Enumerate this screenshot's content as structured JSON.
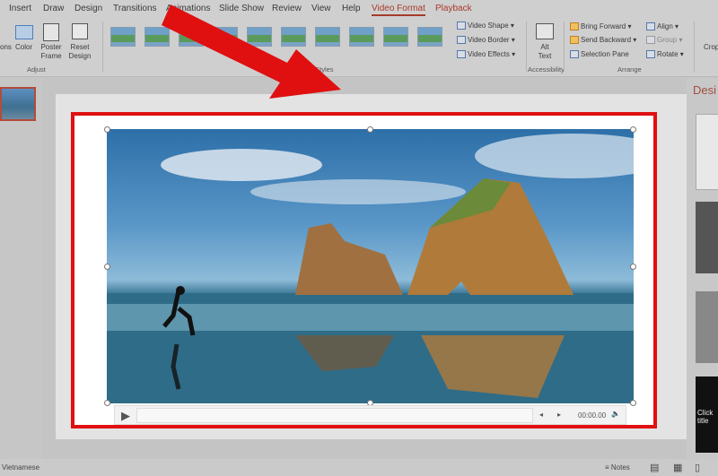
{
  "tabs": [
    "Insert",
    "Draw",
    "Design",
    "Transitions",
    "Animations",
    "Slide Show",
    "Review",
    "View",
    "Help",
    "Video Format",
    "Playback"
  ],
  "active_tab": "Video Format",
  "ribbon": {
    "adjust": {
      "corrections_partial": "ons",
      "color": "Color",
      "poster_frame": "Poster Frame",
      "reset_design": "Reset Design",
      "group": "Adjust"
    },
    "video_styles": {
      "group": "Video Styles",
      "count": 10
    },
    "video_shape": "Video Shape",
    "video_border": "Video Border",
    "video_effects": "Video Effects",
    "alt_text": "Alt Text",
    "accessibility": "Accessibility",
    "bring_forward": "Bring Forward",
    "send_backward": "Send Backward",
    "selection_pane": "Selection Pane",
    "align": "Align",
    "group_btn": "Group",
    "rotate": "Rotate",
    "arrange": "Arrange",
    "crop": "Crop"
  },
  "right_pane": {
    "title": "Desi",
    "click_title": "Click title"
  },
  "player": {
    "time": "00:00.00"
  },
  "status": {
    "language": "Vietnamese",
    "notes": "Notes"
  },
  "colors": {
    "accent": "#a83a2a",
    "annotation": "#e01010"
  }
}
